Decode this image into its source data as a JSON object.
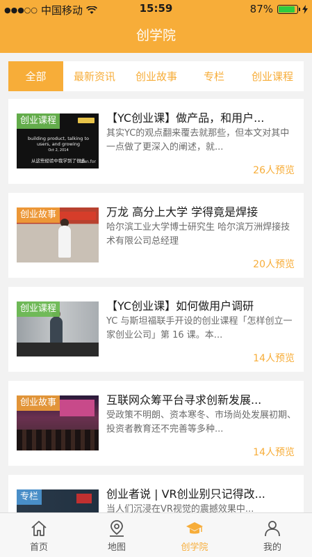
{
  "status_bar": {
    "carrier": "中国移动",
    "time": "15:59",
    "battery": "87%",
    "battery_level": 0.87
  },
  "nav": {
    "title": "创学院"
  },
  "tabs": [
    {
      "label": "全部",
      "active": true
    },
    {
      "label": "最新资讯",
      "active": false
    },
    {
      "label": "创业故事",
      "active": false
    },
    {
      "label": "专栏",
      "active": false
    },
    {
      "label": "创业课程",
      "active": false
    }
  ],
  "articles": [
    {
      "tag": "创业课程",
      "title": "【YC创业课】做产品，和用户...",
      "desc": "其实YC的观点翻来覆去就那些，但本文对其中一点做了更深入的阐述，就...",
      "views": "26人预览",
      "thumb_text": [
        "building product, talking to",
        "users, and growing",
        "Oct 2, 2014",
        "从这些经验中我学到了很多",
        "Stan.for"
      ]
    },
    {
      "tag": "创业故事",
      "title": "万龙  高分上大学  学得竟是焊接",
      "desc": "哈尔滨工业大学博士研究生 哈尔滨万洲焊接技术有限公司总经理",
      "views": "20人预览"
    },
    {
      "tag": "创业课程",
      "title": "【YC创业课】如何做用户调研",
      "desc": "YC 与斯坦福联手开设的创业课程「怎样创立一家创业公司」第 16 课。本...",
      "views": "14人预览"
    },
    {
      "tag": "创业故事",
      "title": "互联网众筹平台寻求创新发展...",
      "desc": "受政策不明朗、资本寒冬、市场尚处发展初期、投资者教育还不完善等多种...",
      "views": "14人预览"
    },
    {
      "tag": "专栏",
      "title": "创业者说 | VR创业别只记得改...",
      "desc": "当人们沉浸在VR视觉的震撼效果中...",
      "views": ""
    }
  ],
  "bottom_tabs": [
    {
      "label": "首页",
      "icon": "home-icon",
      "active": false
    },
    {
      "label": "地图",
      "icon": "map-pin-icon",
      "active": false
    },
    {
      "label": "创学院",
      "icon": "graduation-cap-icon",
      "active": true
    },
    {
      "label": "我的",
      "icon": "user-icon",
      "active": false
    }
  ],
  "colors": {
    "accent": "#f7ad39",
    "background": "#f2f2f2"
  }
}
